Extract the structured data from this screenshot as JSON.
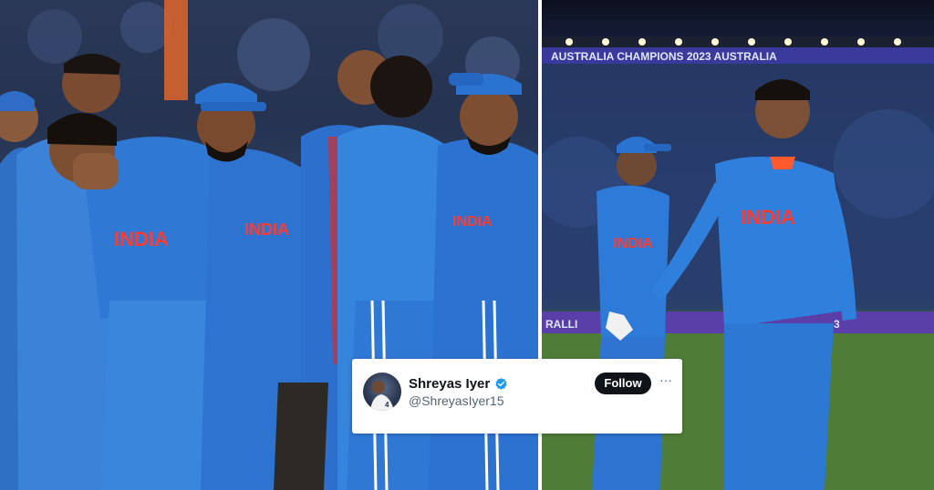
{
  "tweet": {
    "display_name": "Shreyas Iyer",
    "handle": "@ShreyasIyer15",
    "follow_label": "Follow",
    "more_label": "···",
    "accent_color": "#1d9bf0"
  },
  "left_photo": {
    "jersey_text": "INDIA"
  },
  "right_photo": {
    "stadium_banner": "AUSTRALIA   CHAMPIONS 2023   AUSTRALIA",
    "board_text_left": "RALLI",
    "board_text_right": "3",
    "jersey_text": "INDIA"
  },
  "icons": {
    "verified": "verified-badge-icon",
    "more": "more-options-icon"
  }
}
